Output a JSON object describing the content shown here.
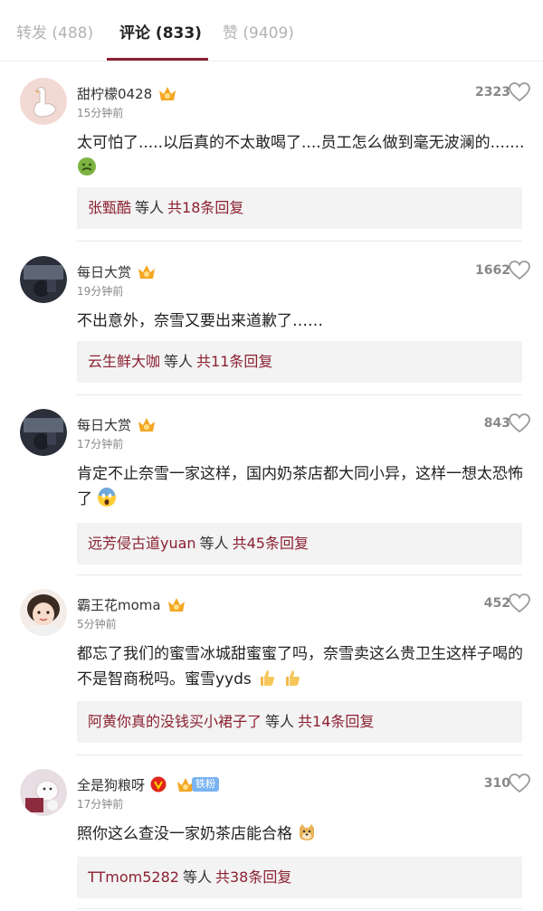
{
  "tabs": [
    {
      "label": "转发 (488)",
      "active": false
    },
    {
      "label": "评论 (833)",
      "active": true
    },
    {
      "label": "赞 (9409)",
      "active": false
    }
  ],
  "comments": [
    {
      "username": "甜柠檬0428",
      "time": "15分钟前",
      "likes": "2323",
      "text": "太可怕了.....以后真的不太敢喝了....员工怎么做到毫无波澜的.......",
      "emoji": "nauseated-face-emoji",
      "reply_user": "张甄酷",
      "reply_mid": "等人",
      "reply_count": "共18条回复"
    },
    {
      "username": "每日大赏",
      "time": "19分钟前",
      "likes": "1662",
      "text": "不出意外，奈雪又要出来道歉了……",
      "reply_user": "云生鲜大咖",
      "reply_mid": "等人",
      "reply_count": "共11条回复"
    },
    {
      "username": "每日大赏",
      "time": "17分钟前",
      "likes": "843",
      "text": "肯定不止奈雪一家这样，国内奶茶店都大同小异，这样一想太恐怖了",
      "emoji": "screaming-face-emoji",
      "reply_user": "远芳侵古道yuan",
      "reply_mid": "等人",
      "reply_count": "共45条回复"
    },
    {
      "username": "霸王花moma",
      "time": "5分钟前",
      "likes": "452",
      "text": "都忘了我们的蜜雪冰城甜蜜蜜了吗，奈雪卖这么贵卫生这样子喝的不是智商税吗。蜜雪yyds",
      "emoji": "thumbs-up-emoji",
      "reply_user": "阿黄你真的没钱买小裙子了",
      "reply_mid": "等人",
      "reply_count": "共14条回复"
    },
    {
      "username": "全是狗粮呀",
      "time": "17分钟前",
      "likes": "310",
      "fan_tag": "铁粉",
      "text": "照你这么查没一家奶茶店能合格",
      "emoji": "doge-emoji",
      "reply_user": "TTmom5282",
      "reply_mid": "等人",
      "reply_count": "共38条回复"
    }
  ],
  "colors": {
    "accent": "#8b2031",
    "reply_bg": "#f3f3f3",
    "muted": "#888888"
  }
}
